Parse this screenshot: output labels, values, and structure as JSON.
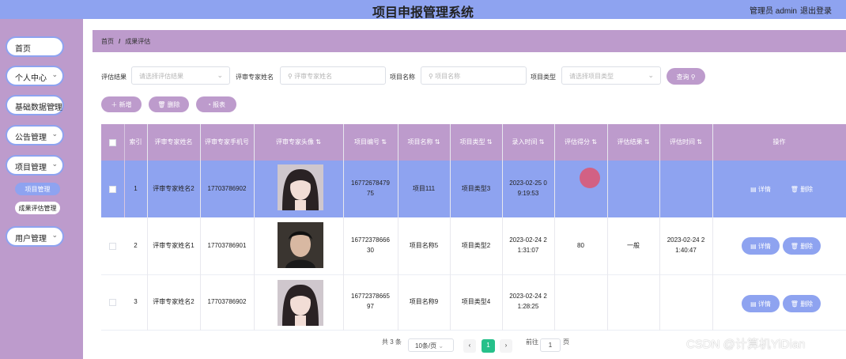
{
  "header": {
    "title": "项目申报管理系统",
    "user_text": "管理员 admin",
    "logout": "退出登录"
  },
  "sidebar": {
    "items": [
      {
        "label": "首页",
        "has_chevron": false
      },
      {
        "label": "个人中心",
        "has_chevron": true
      },
      {
        "label": "基础数据管理",
        "has_chevron": true
      },
      {
        "label": "公告管理",
        "has_chevron": true
      },
      {
        "label": "项目管理",
        "has_chevron": true
      },
      {
        "label": "用户管理",
        "has_chevron": true
      }
    ],
    "subitems": [
      "项目管理",
      "成果评估管理"
    ]
  },
  "breadcrumb": {
    "home": "首页",
    "separator": "/",
    "current": "成果评估"
  },
  "filters": {
    "eval_result_label": "评估结果",
    "eval_result_placeholder": "请选择评估结果",
    "expert_label": "评审专家姓名",
    "expert_placeholder": "评审专家姓名",
    "project_name_label": "项目名称",
    "project_name_placeholder": "项目名称",
    "project_type_label": "项目类型",
    "project_type_placeholder": "请选择项目类型",
    "query_button": "查询"
  },
  "actions": {
    "add": "新增",
    "delete": "删除",
    "report": "报表"
  },
  "table": {
    "headers": [
      "索引",
      "评审专家姓名",
      "评审专家手机号",
      "评审专家头像",
      "项目编号",
      "项目名称",
      "项目类型",
      "录入时间",
      "评估得分",
      "评估结果",
      "评估时间",
      "操作"
    ],
    "rows": [
      {
        "index": "1",
        "expert": "评审专家姓名2",
        "phone": "17703786902",
        "project_no_1": "16772678479",
        "project_no_2": "75",
        "project_name": "项目111",
        "project_type": "项目类型3",
        "time_1": "2023-02-25 0",
        "time_2": "9:19:53",
        "score": "",
        "result": "",
        "eval_time_1": "",
        "eval_time_2": "",
        "selected": true
      },
      {
        "index": "2",
        "expert": "评审专家姓名1",
        "phone": "17703786901",
        "project_no_1": "16772378666",
        "project_no_2": "30",
        "project_name": "项目名称5",
        "project_type": "项目类型2",
        "time_1": "2023-02-24 2",
        "time_2": "1:31:07",
        "score": "80",
        "result": "一般",
        "eval_time_1": "2023-02-24 2",
        "eval_time_2": "1:40:47",
        "selected": false
      },
      {
        "index": "3",
        "expert": "评审专家姓名2",
        "phone": "17703786902",
        "project_no_1": "16772378665",
        "project_no_2": "97",
        "project_name": "项目名称9",
        "project_type": "项目类型4",
        "time_1": "2023-02-24 2",
        "time_2": "1:28:25",
        "score": "",
        "result": "",
        "eval_time_1": "",
        "eval_time_2": "",
        "selected": false
      }
    ],
    "op_detail": "详情",
    "op_delete": "删除"
  },
  "pagination": {
    "total": "共 3 条",
    "page_size": "10条/页",
    "current_page": "1",
    "goto_label": "前往",
    "goto_value": "1",
    "page_unit": "页"
  },
  "watermark": "CSDN @计算机YiDian",
  "colors": {
    "header_bg": "#8ea3f0",
    "sidebar_bg": "#bd9bcc",
    "table_header": "#bd9bcc",
    "selected_row": "#8ea3f0",
    "op_button": "#8ea3f0",
    "page_active": "#26c08a"
  }
}
